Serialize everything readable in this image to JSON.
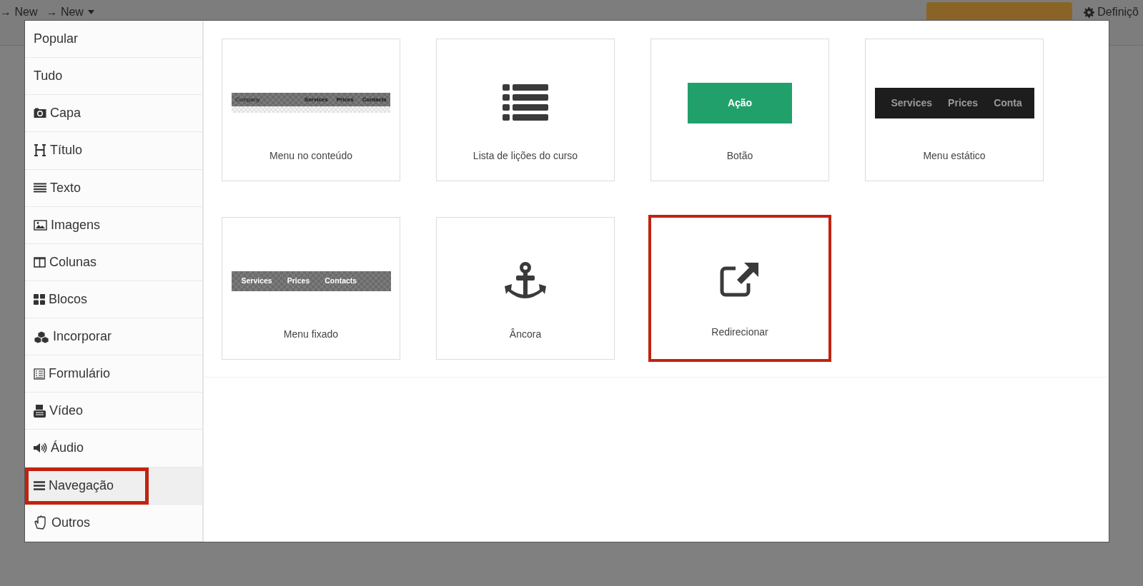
{
  "background_bar": {
    "breadcrumbs": [
      "→ New",
      "→ New"
    ],
    "settings_label": "Definiçõ"
  },
  "sidebar": {
    "items": [
      {
        "label": "Popular",
        "selected": false,
        "highlighted": false
      },
      {
        "label": "Tudo",
        "selected": false,
        "highlighted": false
      },
      {
        "label": "Capa",
        "selected": false,
        "highlighted": false
      },
      {
        "label": "Título",
        "selected": false,
        "highlighted": false
      },
      {
        "label": "Texto",
        "selected": false,
        "highlighted": false
      },
      {
        "label": "Imagens",
        "selected": false,
        "highlighted": false
      },
      {
        "label": "Colunas",
        "selected": false,
        "highlighted": false
      },
      {
        "label": "Blocos",
        "selected": false,
        "highlighted": false
      },
      {
        "label": "Incorporar",
        "selected": false,
        "highlighted": false
      },
      {
        "label": "Formulário",
        "selected": false,
        "highlighted": false
      },
      {
        "label": "Vídeo",
        "selected": false,
        "highlighted": false
      },
      {
        "label": "Áudio",
        "selected": false,
        "highlighted": false
      },
      {
        "label": "Navegação",
        "selected": true,
        "highlighted": true
      },
      {
        "label": "Outros",
        "selected": false,
        "highlighted": false
      }
    ]
  },
  "blocks": [
    {
      "kind": "content-menu",
      "label": "Menu no conteúdo",
      "preview_texts": [
        "Company",
        "Services",
        "Prices",
        "Contacts"
      ],
      "highlighted": false
    },
    {
      "kind": "list",
      "label": "Lista de lições do curso",
      "highlighted": false
    },
    {
      "kind": "button",
      "label": "Botão",
      "preview_texts": [
        "Ação"
      ],
      "highlighted": false
    },
    {
      "kind": "static-menu",
      "label": "Menu estático",
      "preview_texts": [
        "Services",
        "Prices",
        "Conta"
      ],
      "highlighted": false
    },
    {
      "kind": "fixed-menu",
      "label": "Menu fixado",
      "preview_texts": [
        "Services",
        "Prices",
        "Contacts"
      ],
      "highlighted": false
    },
    {
      "kind": "anchor",
      "label": "Âncora",
      "highlighted": false
    },
    {
      "kind": "redirect",
      "label": "Redirecionar",
      "highlighted": true
    }
  ]
}
